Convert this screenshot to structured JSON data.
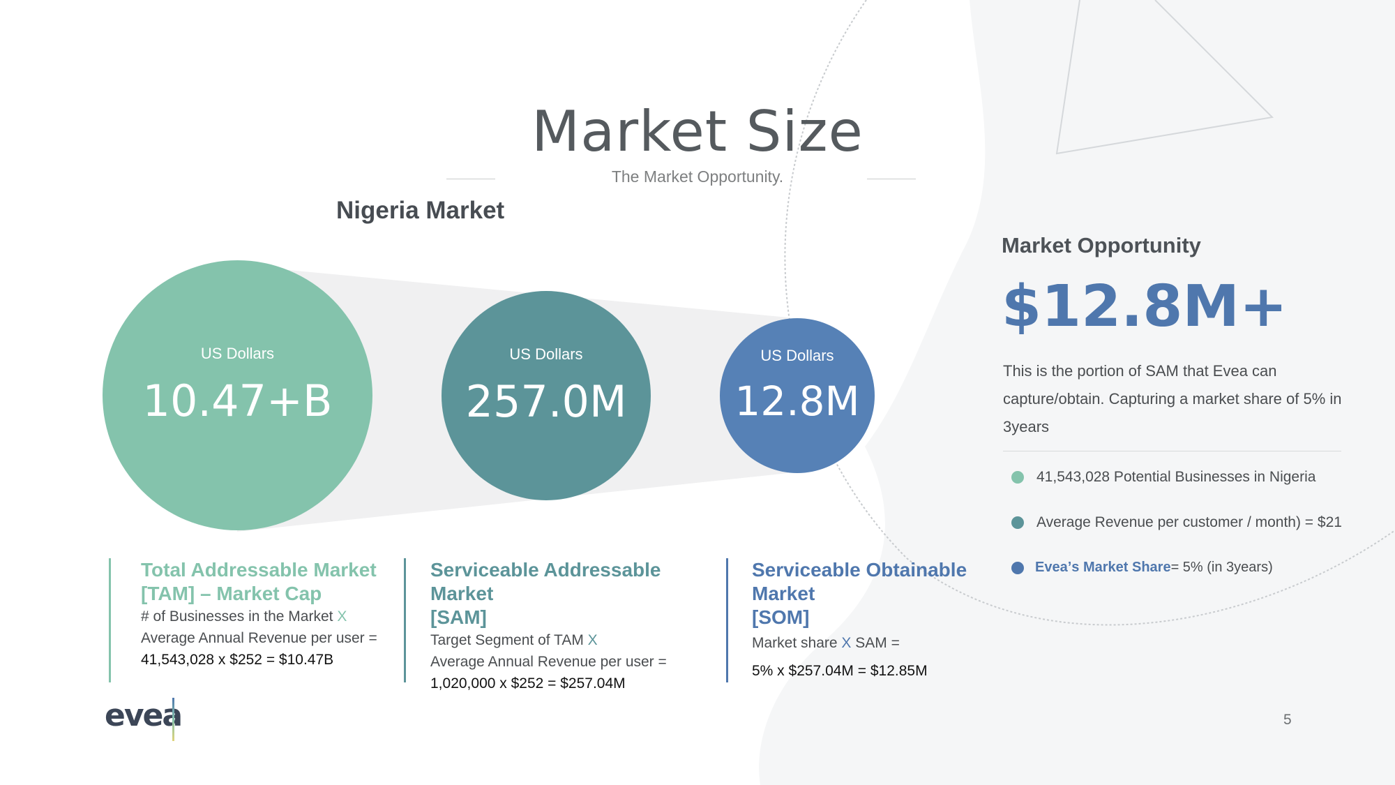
{
  "slide": {
    "title": "Market Size",
    "subtitle": "The Market Opportunity.",
    "page_number": "5"
  },
  "nigeria": {
    "heading": "Nigeria Market",
    "circles": [
      {
        "unit": "US Dollars",
        "value": "10.47+B",
        "color": "#84c3ac"
      },
      {
        "unit": "US Dollars",
        "value": "257.0M",
        "color": "#5c9499"
      },
      {
        "unit": "US Dollars",
        "value": "12.8M",
        "color": "#5681b6"
      }
    ]
  },
  "columns": {
    "tam": {
      "title_line1": "Total Addressable Market",
      "title_line2": "[TAM] – Market Cap",
      "line1_text": "# of Businesses in the Market",
      "line1_op": "X",
      "line2_text": "Average Annual Revenue per user =",
      "equation": "41,543,028 x $252 = $10.47B",
      "color": "#84c3ac"
    },
    "sam": {
      "title_line1": "Serviceable Addressable Market",
      "title_line2": "[SAM]",
      "line1_text": "Target Segment of TAM",
      "line1_op": "X",
      "line2_text": "Average Annual Revenue per user =",
      "equation": "1,020,000 x $252 = $257.04M",
      "color": "#5c9499"
    },
    "som": {
      "title_line1": "Serviceable Obtainable Market",
      "title_line2": "[SOM]",
      "line1_a": "Market share",
      "line1_op": "X",
      "line1_b": "SAM =",
      "equation": "5% x $257.04M = $12.85M",
      "color": "#4f77ad"
    }
  },
  "opportunity": {
    "heading": "Market Opportunity",
    "value": "$12.8M+",
    "description": "This is the portion of SAM that Evea can capture/obtain. Capturing a market share of 5% in 3years",
    "bullets": [
      {
        "text": "41,543,028 Potential Businesses in Nigeria",
        "color": "#84c3ac"
      },
      {
        "text": "Average Revenue per customer / month) = $21",
        "color": "#5c9499"
      },
      {
        "label": "Eveа’s Market Share",
        "text": " = 5% (in 3years)",
        "color": "#4f77ad"
      }
    ]
  },
  "logo": {
    "text": "evea"
  }
}
